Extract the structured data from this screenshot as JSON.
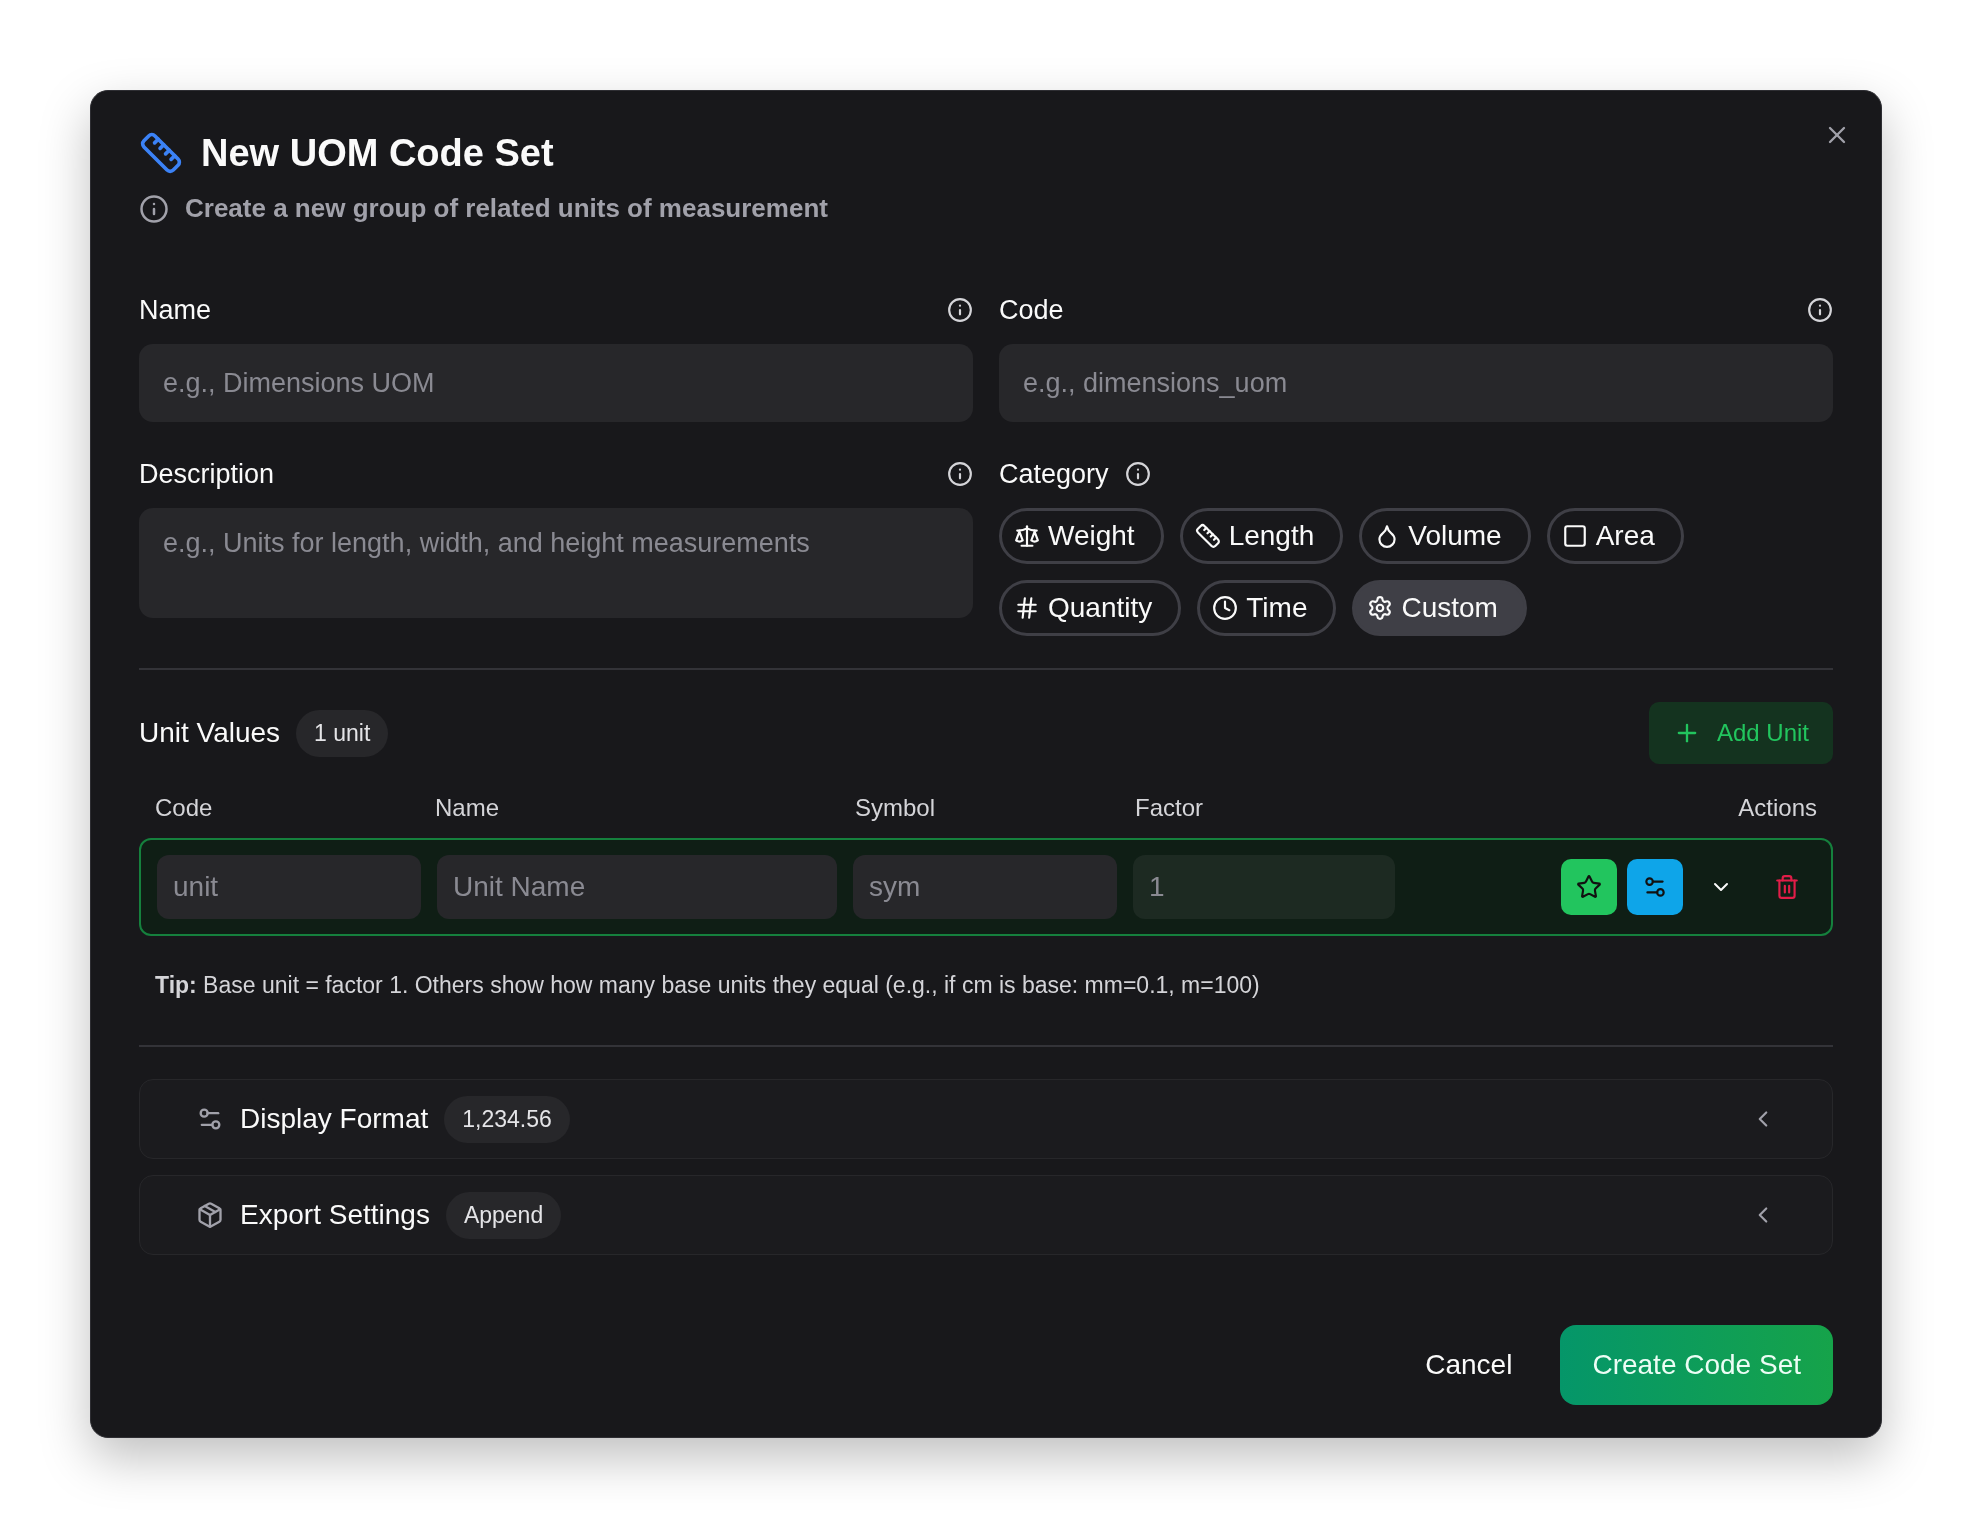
{
  "dialog": {
    "title": "New UOM Code Set",
    "subtitle": "Create a new group of related units of measurement"
  },
  "fields": {
    "name": {
      "label": "Name",
      "placeholder": "e.g., Dimensions UOM"
    },
    "code": {
      "label": "Code",
      "placeholder": "e.g., dimensions_uom"
    },
    "description": {
      "label": "Description",
      "placeholder": "e.g., Units for length, width, and height measurements"
    }
  },
  "category": {
    "label": "Category",
    "options": [
      {
        "label": "Weight",
        "selected": false
      },
      {
        "label": "Length",
        "selected": false
      },
      {
        "label": "Volume",
        "selected": false
      },
      {
        "label": "Area",
        "selected": false
      },
      {
        "label": "Quantity",
        "selected": false
      },
      {
        "label": "Time",
        "selected": false
      },
      {
        "label": "Custom",
        "selected": true
      }
    ]
  },
  "unit_values": {
    "title": "Unit Values",
    "count": "1 unit",
    "add_button": "Add Unit",
    "columns": [
      "Code",
      "Name",
      "Symbol",
      "Factor",
      "Actions"
    ],
    "rows": [
      {
        "code_placeholder": "unit",
        "name_placeholder": "Unit Name",
        "symbol_placeholder": "sym",
        "factor_placeholder": "1",
        "base": true
      }
    ],
    "tip": "**Tip:** Base unit = factor 1. Others show how many base units they equal (e.g., if cm is base: mm=0.1, m=100)"
  },
  "sections": [
    {
      "title": "Display Format",
      "badge": "1,234.56",
      "expanded": false
    },
    {
      "title": "Export Settings",
      "badge": "Append",
      "expanded": false
    }
  ],
  "buttons": {
    "cancel": "Cancel",
    "submit": "Create Code Set"
  }
}
